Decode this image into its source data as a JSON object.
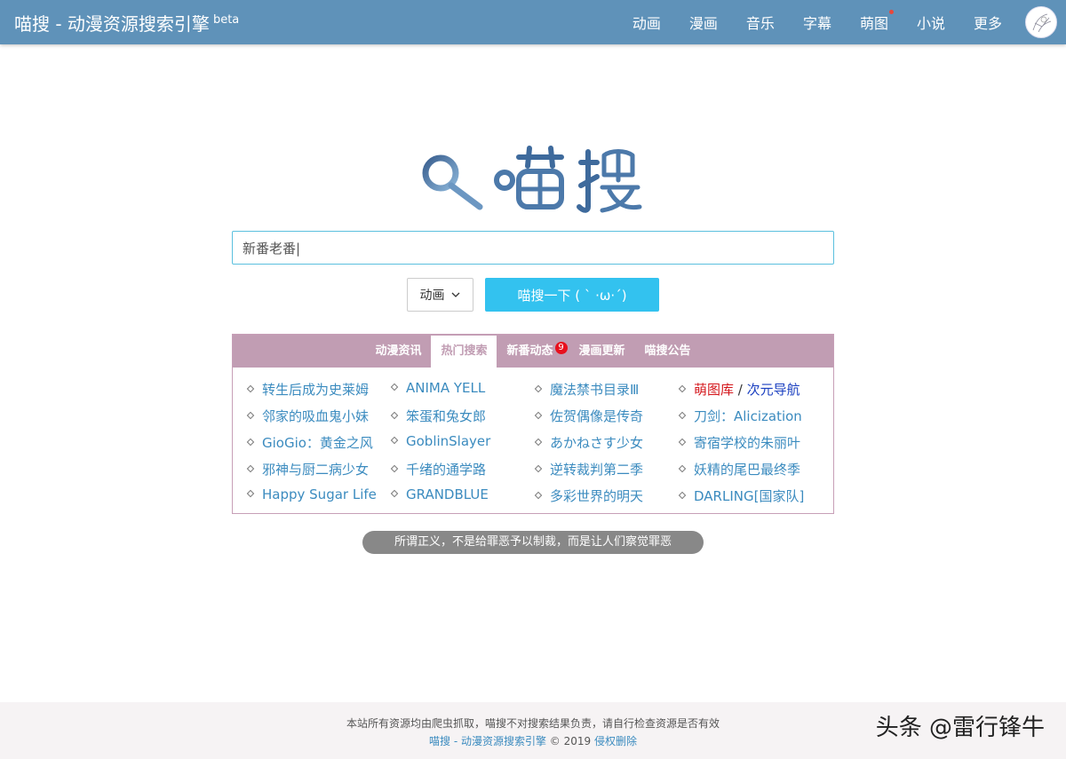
{
  "header": {
    "brand": "喵搜 - 动漫资源搜索引擎",
    "brand_sup": "beta",
    "nav": [
      "动画",
      "漫画",
      "音乐",
      "字幕",
      "萌图",
      "小说",
      "更多"
    ],
    "accent": "#5f92b9"
  },
  "search": {
    "value": "新番老番|",
    "type_selected": "动画",
    "button_label": "喵搜一下 ( ` ·ω·´)"
  },
  "tabs": {
    "items": [
      "动漫资讯",
      "热门搜索",
      "新番动态",
      "漫画更新",
      "喵搜公告"
    ],
    "active": "热门搜索",
    "badge": "9",
    "color": "#c19db3"
  },
  "hot": {
    "col1": [
      "转生后成为史莱姆",
      "邻家的吸血鬼小妹",
      "GioGio：黄金之风",
      "邪神与厨二病少女",
      "Happy Sugar Life"
    ],
    "col2": [
      "ANIMA YELL",
      "笨蛋和兔女郎",
      "GoblinSlayer",
      "千绪的通学路",
      "GRANDBLUE"
    ],
    "col3": [
      "魔法禁书目录Ⅲ",
      "佐贺偶像是传奇",
      "あかねさす少女",
      "逆转裁判第二季",
      "多彩世界的明天"
    ],
    "col4_first_a": "萌图库",
    "col4_first_sep": "/",
    "col4_first_b": "次元导航",
    "col4": [
      "刀剑：Alicization",
      "寄宿学校的朱丽叶",
      "妖精的尾巴最终季",
      "DARLING[国家队]"
    ]
  },
  "quote": "所谓正义，不是给罪恶予以制裁，而是让人们察觉罪恶",
  "footer": {
    "line1": "本站所有资源均由爬虫抓取，喵搜不对搜索结果负责，请自行检查资源是否有效",
    "site_link": "喵搜 - 动漫资源搜索引擎",
    "copyright": "© 2019",
    "removal_link": "侵权删除"
  },
  "watermark": "头条 @雷行锋牛"
}
